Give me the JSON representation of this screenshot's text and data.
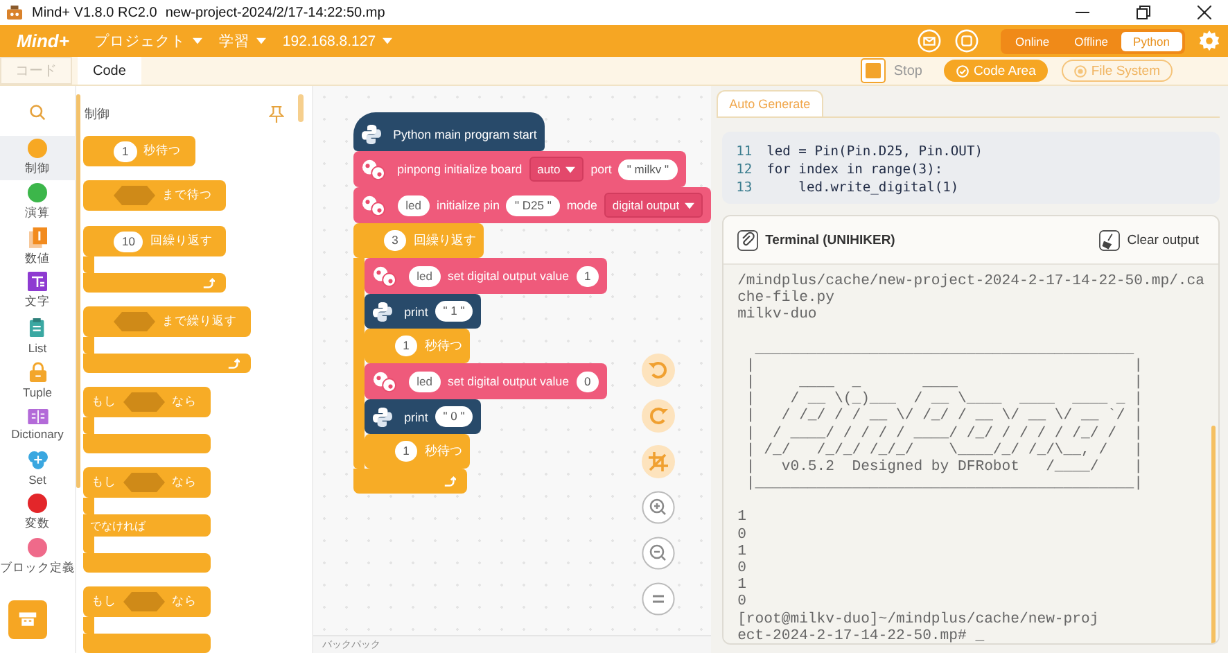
{
  "window": {
    "title": "Mind+ V1.8.0 RC2.0",
    "file": "new-project-2024/2/17-14:22:50.mp"
  },
  "menu": {
    "logo": "Mind+",
    "items": [
      {
        "label": "プロジェクト"
      },
      {
        "label": "学習"
      },
      {
        "label": "192.168.8.127"
      }
    ],
    "modes": [
      {
        "label": "Online",
        "selected": false
      },
      {
        "label": "Offline",
        "selected": false
      },
      {
        "label": "Python",
        "selected": true
      }
    ]
  },
  "toolbar": {
    "tabs": [
      {
        "label": "コード",
        "selected": false
      },
      {
        "label": "Code",
        "selected": true
      }
    ],
    "buttons": [
      {
        "label": "Stop",
        "kind": "stop",
        "selected": false
      },
      {
        "label": "Code Area",
        "kind": "toggle",
        "selected": true
      },
      {
        "label": "File System",
        "kind": "toggle",
        "selected": false
      }
    ]
  },
  "categories": [
    {
      "label": "制御",
      "kind": "dot",
      "color": "#f7a823",
      "selected": true
    },
    {
      "label": "演算",
      "kind": "dot",
      "color": "#3cb64a",
      "selected": false
    },
    {
      "label": "数値",
      "kind": "number",
      "color": "#f28b1e",
      "selected": false
    },
    {
      "label": "文字",
      "kind": "text",
      "color": "#8e3bd1",
      "selected": false
    },
    {
      "label": "List",
      "kind": "list",
      "color": "#3aa8a2",
      "selected": false
    },
    {
      "label": "Tuple",
      "kind": "tuple",
      "color": "#f3a62b",
      "selected": false
    },
    {
      "label": "Dictionary",
      "kind": "dict",
      "color": "#b36ad8",
      "selected": false
    },
    {
      "label": "Set",
      "kind": "set",
      "color": "#3aa7e0",
      "selected": false
    },
    {
      "label": "変数",
      "kind": "dot",
      "color": "#e3262a",
      "selected": false
    },
    {
      "label": "ブロック定義",
      "kind": "dot",
      "color": "#ef6a8a",
      "selected": false
    }
  ],
  "palette": {
    "title": "制御",
    "blocks": [
      {
        "kind": "control",
        "parts": [
          {
            "kind": "num",
            "text": "1"
          },
          {
            "kind": "label",
            "text": "秒待つ"
          }
        ]
      },
      {
        "kind": "control",
        "parts": [
          {
            "kind": "hex"
          },
          {
            "kind": "label",
            "text": "まで待つ"
          }
        ]
      },
      {
        "kind": "loop",
        "parts": [
          {
            "kind": "num",
            "text": "10"
          },
          {
            "kind": "label",
            "text": "回繰り返す"
          }
        ]
      },
      {
        "kind": "loop",
        "parts": [
          {
            "kind": "hex"
          },
          {
            "kind": "label",
            "text": "まで繰り返す"
          }
        ]
      },
      {
        "kind": "if",
        "parts": [
          {
            "kind": "label",
            "text": "もし"
          },
          {
            "kind": "hex"
          },
          {
            "kind": "label",
            "text": "なら"
          }
        ]
      },
      {
        "kind": "if_else",
        "else_label": "でなければ",
        "parts": [
          {
            "kind": "label",
            "text": "もし"
          },
          {
            "kind": "hex"
          },
          {
            "kind": "label",
            "text": "なら"
          }
        ]
      },
      {
        "kind": "if",
        "parts": [
          {
            "kind": "label",
            "text": "もし"
          },
          {
            "kind": "hex"
          },
          {
            "kind": "label",
            "text": "なら"
          }
        ]
      }
    ]
  },
  "workspace": {
    "blocks": [
      {
        "kind": "python_start",
        "parts": [
          {
            "kind": "label",
            "text": "Python main program start"
          }
        ]
      },
      {
        "kind": "pinpong",
        "parts": [
          {
            "kind": "label",
            "text": "pinpong initialize board"
          },
          {
            "kind": "drop",
            "text": "auto"
          },
          {
            "kind": "label",
            "text": "port"
          },
          {
            "kind": "str",
            "text": "\" milkv \""
          }
        ]
      },
      {
        "kind": "pinpong",
        "parts": [
          {
            "kind": "var",
            "text": "led"
          },
          {
            "kind": "label",
            "text": "initialize pin"
          },
          {
            "kind": "str",
            "text": "\" D25 \""
          },
          {
            "kind": "label",
            "text": "mode"
          },
          {
            "kind": "drop",
            "text": "digital output"
          }
        ]
      },
      {
        "kind": "loop",
        "parts": [
          {
            "kind": "num",
            "text": "3"
          },
          {
            "kind": "label",
            "text": "回繰り返す"
          }
        ],
        "children": [
          {
            "kind": "pinpong",
            "parts": [
              {
                "kind": "var",
                "text": "led"
              },
              {
                "kind": "label",
                "text": "set digital output value"
              },
              {
                "kind": "num",
                "text": "1"
              }
            ]
          },
          {
            "kind": "python",
            "parts": [
              {
                "kind": "label",
                "text": "print"
              },
              {
                "kind": "str",
                "text": "\" 1 \""
              }
            ]
          },
          {
            "kind": "control",
            "parts": [
              {
                "kind": "num",
                "text": "1"
              },
              {
                "kind": "label",
                "text": "秒待つ"
              }
            ]
          },
          {
            "kind": "pinpong",
            "parts": [
              {
                "kind": "var",
                "text": "led"
              },
              {
                "kind": "label",
                "text": "set digital output value"
              },
              {
                "kind": "num",
                "text": "0"
              }
            ]
          },
          {
            "kind": "python",
            "parts": [
              {
                "kind": "label",
                "text": "print"
              },
              {
                "kind": "str",
                "text": "\" 0 \""
              }
            ]
          },
          {
            "kind": "control",
            "parts": [
              {
                "kind": "num",
                "text": "1"
              },
              {
                "kind": "label",
                "text": "秒待つ"
              }
            ]
          }
        ]
      }
    ],
    "backpack": "バックパック"
  },
  "code_panel": {
    "tabs": [
      {
        "label": "Auto Generate",
        "selected": true
      }
    ],
    "lines": [
      {
        "number": "11",
        "code": "led = Pin(Pin.D25, Pin.OUT)"
      },
      {
        "number": "12",
        "code": "for index in range(3):"
      },
      {
        "number": "13",
        "code": "    led.write_digital(1)"
      }
    ]
  },
  "terminal": {
    "title": "Terminal (UNIHIKER)",
    "clear": "Clear output",
    "groups": [
      {
        "lines": [
          "/mindplus/cache/new-project-2024-2-17-14-22-50.mp/.ca",
          "che-file.py",
          "milkv-duo"
        ]
      },
      {
        "lines": [
          "  ___________________________________________",
          " |                                           |",
          " |     ____  _       ____                    |",
          " |    / __ \\(_)___  / __ \\____  ____  ____ _ |",
          " |   / /_/ / / __ \\/ /_/ / __ \\/ __ \\/ __ `/ |",
          " |  / ____/ / / / / ____/ /_/ / / / / /_/ /  |",
          " | /_/   /_/_/ /_/_/    \\____/_/ /_/\\__, /   |",
          " |   v0.5.2  Designed by DFRobot   /____/    |",
          " |___________________________________________|"
        ]
      },
      {
        "lines": [
          "1",
          "0",
          "1",
          "0",
          "1",
          "0",
          "[root@milkv-duo]~/mindplus/cache/new-proj",
          "ect-2024-2-17-14-22-50.mp# _"
        ]
      }
    ]
  }
}
